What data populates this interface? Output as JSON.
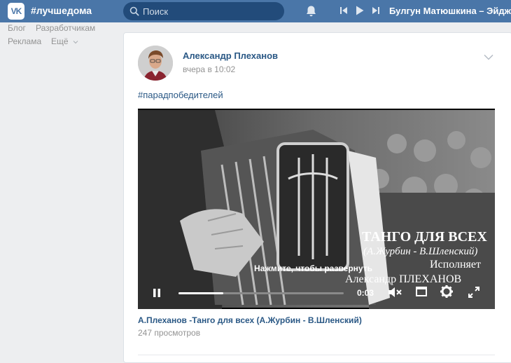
{
  "header": {
    "logo_text": "VK",
    "hashtag": "#лучшедома",
    "search_placeholder": "Поиск",
    "now_playing": "Булгун Матюшкина – Эйдже"
  },
  "leftnav": {
    "row1": [
      "Блог",
      "Разработчикам"
    ],
    "row2": [
      "Реклама",
      "Ещё"
    ]
  },
  "post": {
    "author": "Александр Плеханов",
    "time": "вчера в 10:02",
    "hashtag": "#парадпобедителей",
    "video": {
      "overlay_title": "ТАНГО ДЛЯ ВСЕХ",
      "overlay_authors": "(А.Журбин - В.Шленский)",
      "overlay_performer_label": "Исполняет",
      "overlay_performer": "Александр ПЛЕХАНОВ",
      "hint": "Нажмите, чтобы развернуть",
      "time": "0:03",
      "progress": 0.27,
      "state": "playing",
      "muted": true
    },
    "video_title": "А.Плеханов -Танго для всех (А.Журбин - В.Шленский)",
    "views": "247 просмотров"
  },
  "colors": {
    "header_bg": "#4a76a8",
    "search_bg": "#224b7a",
    "link": "#2a5885",
    "muted": "#939393",
    "page_bg": "#edeef0"
  }
}
